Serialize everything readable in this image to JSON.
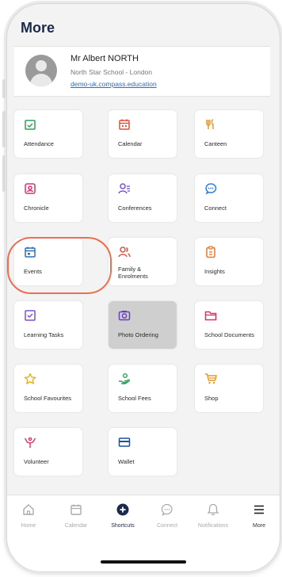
{
  "header": {
    "title": "More"
  },
  "profile": {
    "name": "Mr Albert NORTH",
    "school": "North Star School - London",
    "link": "demo-uk.compass.education"
  },
  "tiles": [
    {
      "label": "Attendance",
      "icon": "attendance-icon",
      "color": "#2e9e58"
    },
    {
      "label": "Calendar",
      "icon": "calendar-icon",
      "color": "#e0503c"
    },
    {
      "label": "Canteen",
      "icon": "canteen-icon",
      "color": "#e59a2a"
    },
    {
      "label": "Chronicle",
      "icon": "chronicle-icon",
      "color": "#d6336c"
    },
    {
      "label": "Conferences",
      "icon": "conferences-icon",
      "color": "#7b4fd6"
    },
    {
      "label": "Connect",
      "icon": "connect-icon",
      "color": "#2f7ed8"
    },
    {
      "label": "Events",
      "icon": "events-icon",
      "color": "#2f6fb5"
    },
    {
      "label": "Family & Enrolments",
      "icon": "family-icon",
      "color": "#e05040"
    },
    {
      "label": "Insights",
      "icon": "insights-icon",
      "color": "#e07a2a"
    },
    {
      "label": "Learning Tasks",
      "icon": "learning-tasks-icon",
      "color": "#7b4fd6"
    },
    {
      "label": "Photo Ordering",
      "icon": "photo-icon",
      "color": "#6a3fc0"
    },
    {
      "label": "School Documents",
      "icon": "school-documents-icon",
      "color": "#d6336c"
    },
    {
      "label": "School Favourites",
      "icon": "star-icon",
      "color": "#e5b020"
    },
    {
      "label": "School Fees",
      "icon": "school-fees-icon",
      "color": "#2e9e58"
    },
    {
      "label": "Shop",
      "icon": "shop-icon",
      "color": "#e59a2a"
    },
    {
      "label": "Volunteer",
      "icon": "volunteer-icon",
      "color": "#d6336c"
    },
    {
      "label": "Wallet",
      "icon": "wallet-icon",
      "color": "#1f4f9a"
    }
  ],
  "tabbar": {
    "items": [
      {
        "label": "Home",
        "icon": "home-icon"
      },
      {
        "label": "Calendar",
        "icon": "calendar-icon"
      },
      {
        "label": "Shortcuts",
        "icon": "plus-icon"
      },
      {
        "label": "Connect",
        "icon": "chat-icon"
      },
      {
        "label": "Notifications",
        "icon": "bell-icon"
      },
      {
        "label": "More",
        "icon": "menu-icon"
      }
    ],
    "active": "Shortcuts",
    "accent": "#1b2a4a"
  }
}
